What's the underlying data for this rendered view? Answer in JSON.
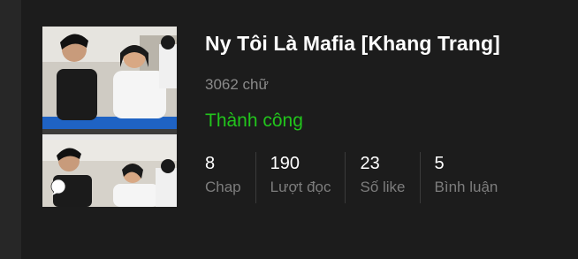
{
  "story": {
    "title": "Ny Tôi Là Mafia [Khang Trang]",
    "word_count": "3062 chữ",
    "status": "Thành công",
    "status_color": "#22c41c"
  },
  "stats": [
    {
      "value": "8",
      "label": "Chap"
    },
    {
      "value": "190",
      "label": "Lượt đọc"
    },
    {
      "value": "23",
      "label": "Số like"
    },
    {
      "value": "5",
      "label": "Bình luận"
    }
  ],
  "icons": {
    "cover_overlay": "speech-bubble-icon"
  }
}
